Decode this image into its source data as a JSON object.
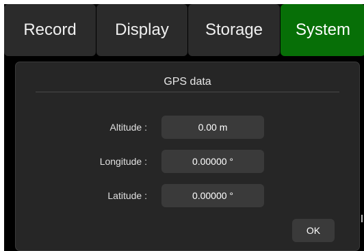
{
  "tabs": [
    {
      "label": "Record",
      "active": false
    },
    {
      "label": "Display",
      "active": false
    },
    {
      "label": "Storage",
      "active": false
    },
    {
      "label": "System",
      "active": true
    }
  ],
  "colors": {
    "active_tab": "#076f07",
    "tab": "#2b2b2b",
    "panel": "#262626",
    "field": "#3a3a3a"
  },
  "dialog": {
    "title": "GPS data",
    "fields": [
      {
        "label": "Altitude :",
        "value": "0.00 m"
      },
      {
        "label": "Longitude :",
        "value": "0.00000 °"
      },
      {
        "label": "Latitude :",
        "value": "0.00000 °"
      }
    ],
    "ok_label": "OK"
  }
}
